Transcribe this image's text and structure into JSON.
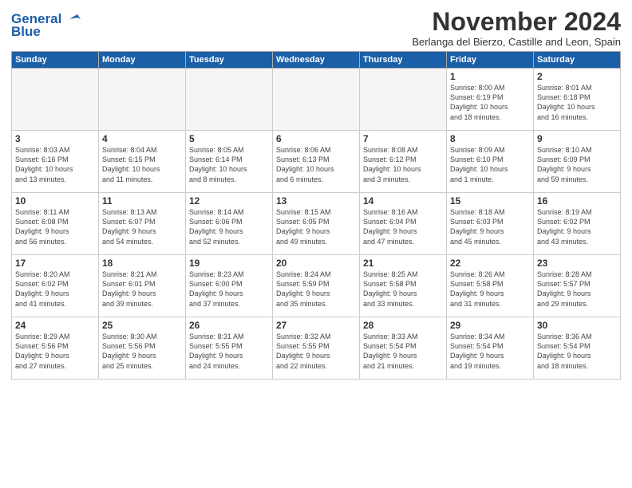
{
  "logo": {
    "line1": "General",
    "line2": "Blue"
  },
  "title": "November 2024",
  "subtitle": "Berlanga del Bierzo, Castille and Leon, Spain",
  "days_of_week": [
    "Sunday",
    "Monday",
    "Tuesday",
    "Wednesday",
    "Thursday",
    "Friday",
    "Saturday"
  ],
  "weeks": [
    [
      {
        "day": "",
        "info": ""
      },
      {
        "day": "",
        "info": ""
      },
      {
        "day": "",
        "info": ""
      },
      {
        "day": "",
        "info": ""
      },
      {
        "day": "",
        "info": ""
      },
      {
        "day": "1",
        "info": "Sunrise: 8:00 AM\nSunset: 6:19 PM\nDaylight: 10 hours\nand 18 minutes."
      },
      {
        "day": "2",
        "info": "Sunrise: 8:01 AM\nSunset: 6:18 PM\nDaylight: 10 hours\nand 16 minutes."
      }
    ],
    [
      {
        "day": "3",
        "info": "Sunrise: 8:03 AM\nSunset: 6:16 PM\nDaylight: 10 hours\nand 13 minutes."
      },
      {
        "day": "4",
        "info": "Sunrise: 8:04 AM\nSunset: 6:15 PM\nDaylight: 10 hours\nand 11 minutes."
      },
      {
        "day": "5",
        "info": "Sunrise: 8:05 AM\nSunset: 6:14 PM\nDaylight: 10 hours\nand 8 minutes."
      },
      {
        "day": "6",
        "info": "Sunrise: 8:06 AM\nSunset: 6:13 PM\nDaylight: 10 hours\nand 6 minutes."
      },
      {
        "day": "7",
        "info": "Sunrise: 8:08 AM\nSunset: 6:12 PM\nDaylight: 10 hours\nand 3 minutes."
      },
      {
        "day": "8",
        "info": "Sunrise: 8:09 AM\nSunset: 6:10 PM\nDaylight: 10 hours\nand 1 minute."
      },
      {
        "day": "9",
        "info": "Sunrise: 8:10 AM\nSunset: 6:09 PM\nDaylight: 9 hours\nand 59 minutes."
      }
    ],
    [
      {
        "day": "10",
        "info": "Sunrise: 8:11 AM\nSunset: 6:08 PM\nDaylight: 9 hours\nand 56 minutes."
      },
      {
        "day": "11",
        "info": "Sunrise: 8:13 AM\nSunset: 6:07 PM\nDaylight: 9 hours\nand 54 minutes."
      },
      {
        "day": "12",
        "info": "Sunrise: 8:14 AM\nSunset: 6:06 PM\nDaylight: 9 hours\nand 52 minutes."
      },
      {
        "day": "13",
        "info": "Sunrise: 8:15 AM\nSunset: 6:05 PM\nDaylight: 9 hours\nand 49 minutes."
      },
      {
        "day": "14",
        "info": "Sunrise: 8:16 AM\nSunset: 6:04 PM\nDaylight: 9 hours\nand 47 minutes."
      },
      {
        "day": "15",
        "info": "Sunrise: 8:18 AM\nSunset: 6:03 PM\nDaylight: 9 hours\nand 45 minutes."
      },
      {
        "day": "16",
        "info": "Sunrise: 8:19 AM\nSunset: 6:02 PM\nDaylight: 9 hours\nand 43 minutes."
      }
    ],
    [
      {
        "day": "17",
        "info": "Sunrise: 8:20 AM\nSunset: 6:02 PM\nDaylight: 9 hours\nand 41 minutes."
      },
      {
        "day": "18",
        "info": "Sunrise: 8:21 AM\nSunset: 6:01 PM\nDaylight: 9 hours\nand 39 minutes."
      },
      {
        "day": "19",
        "info": "Sunrise: 8:23 AM\nSunset: 6:00 PM\nDaylight: 9 hours\nand 37 minutes."
      },
      {
        "day": "20",
        "info": "Sunrise: 8:24 AM\nSunset: 5:59 PM\nDaylight: 9 hours\nand 35 minutes."
      },
      {
        "day": "21",
        "info": "Sunrise: 8:25 AM\nSunset: 5:58 PM\nDaylight: 9 hours\nand 33 minutes."
      },
      {
        "day": "22",
        "info": "Sunrise: 8:26 AM\nSunset: 5:58 PM\nDaylight: 9 hours\nand 31 minutes."
      },
      {
        "day": "23",
        "info": "Sunrise: 8:28 AM\nSunset: 5:57 PM\nDaylight: 9 hours\nand 29 minutes."
      }
    ],
    [
      {
        "day": "24",
        "info": "Sunrise: 8:29 AM\nSunset: 5:56 PM\nDaylight: 9 hours\nand 27 minutes."
      },
      {
        "day": "25",
        "info": "Sunrise: 8:30 AM\nSunset: 5:56 PM\nDaylight: 9 hours\nand 25 minutes."
      },
      {
        "day": "26",
        "info": "Sunrise: 8:31 AM\nSunset: 5:55 PM\nDaylight: 9 hours\nand 24 minutes."
      },
      {
        "day": "27",
        "info": "Sunrise: 8:32 AM\nSunset: 5:55 PM\nDaylight: 9 hours\nand 22 minutes."
      },
      {
        "day": "28",
        "info": "Sunrise: 8:33 AM\nSunset: 5:54 PM\nDaylight: 9 hours\nand 21 minutes."
      },
      {
        "day": "29",
        "info": "Sunrise: 8:34 AM\nSunset: 5:54 PM\nDaylight: 9 hours\nand 19 minutes."
      },
      {
        "day": "30",
        "info": "Sunrise: 8:36 AM\nSunset: 5:54 PM\nDaylight: 9 hours\nand 18 minutes."
      }
    ]
  ]
}
